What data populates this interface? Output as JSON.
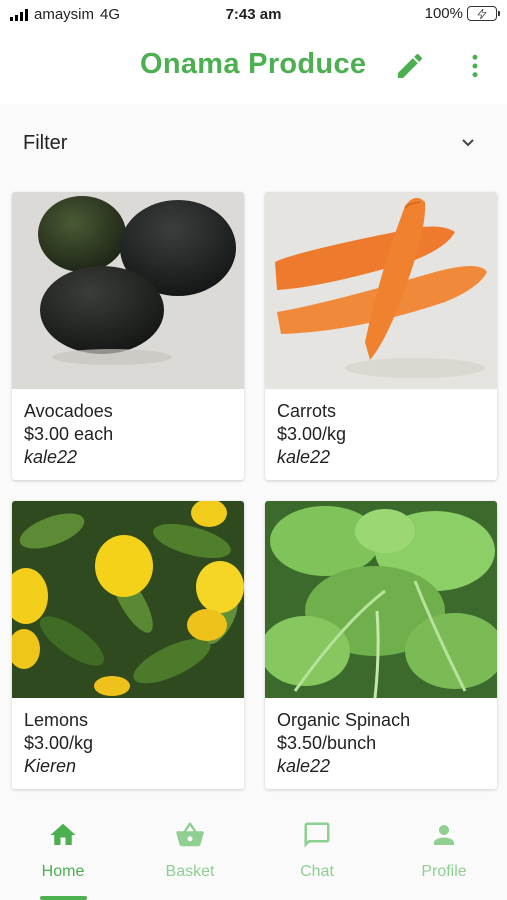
{
  "status_bar": {
    "carrier": "amaysim",
    "network": "4G",
    "time": "7:43 am",
    "battery": "100%"
  },
  "app_bar": {
    "title": "Onama Produce",
    "edit_icon": "pencil-icon",
    "more_icon": "more-vert-icon"
  },
  "filter": {
    "label": "Filter",
    "icon": "chevron-down-icon"
  },
  "products": [
    {
      "name": "Avocadoes",
      "price": "$3.00 each",
      "seller": "kale22"
    },
    {
      "name": "Carrots",
      "price": "$3.00/kg",
      "seller": "kale22"
    },
    {
      "name": "Lemons",
      "price": "$3.00/kg",
      "seller": "Kieren"
    },
    {
      "name": "Organic Spinach",
      "price": "$3.50/bunch",
      "seller": "kale22"
    }
  ],
  "nav": {
    "items": [
      {
        "label": "Home",
        "icon": "home-icon"
      },
      {
        "label": "Basket",
        "icon": "basket-icon"
      },
      {
        "label": "Chat",
        "icon": "chat-icon"
      },
      {
        "label": "Profile",
        "icon": "profile-icon"
      }
    ],
    "active": "Home"
  },
  "colors": {
    "accent": "#4caf50",
    "accent_light": "#8fcf92",
    "background": "#fafafa"
  }
}
